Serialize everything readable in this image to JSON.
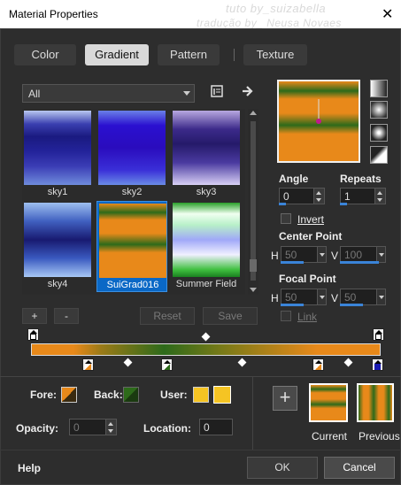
{
  "window": {
    "title": "Material Properties",
    "watermark_line1": "tuto by_suizabella",
    "watermark_line2": "tradução by_ Neusa Novaes",
    "close_label": "✕"
  },
  "tabs": [
    {
      "label": "Color",
      "active": false
    },
    {
      "label": "Gradient",
      "active": true
    },
    {
      "label": "Pattern",
      "active": false
    },
    {
      "label": "Texture",
      "active": false
    }
  ],
  "category_dropdown": {
    "value": "All"
  },
  "gradients": [
    {
      "name": "sky1"
    },
    {
      "name": "sky2"
    },
    {
      "name": "sky3"
    },
    {
      "name": "sky4"
    },
    {
      "name": "SuiGrad016",
      "selected": true
    },
    {
      "name": "Summer Field"
    }
  ],
  "library_buttons": {
    "add": "+",
    "remove": "-",
    "reset": "Reset",
    "save": "Save"
  },
  "angle": {
    "label": "Angle",
    "value": "0"
  },
  "repeats": {
    "label": "Repeats",
    "value": "1"
  },
  "invert": {
    "label": "Invert",
    "checked": false
  },
  "center_point": {
    "label": "Center Point",
    "h_label": "H",
    "h_value": "50",
    "v_label": "V",
    "v_value": "100"
  },
  "focal_point": {
    "label": "Focal Point",
    "h_label": "H",
    "h_value": "50",
    "v_label": "V",
    "v_value": "50"
  },
  "link": {
    "label": "Link",
    "checked": false
  },
  "stops": {
    "fore_label": "Fore:",
    "back_label": "Back:",
    "user_label": "User:",
    "opacity_label": "Opacity:",
    "opacity_value": "0",
    "location_label": "Location:",
    "location_value": "0"
  },
  "colors": {
    "orange": "#e8891a",
    "green": "#2d6a1a",
    "yellow": "#f5c423",
    "accent": "#3a84d8"
  },
  "result": {
    "add": "+",
    "current_label": "Current",
    "previous_label": "Previous"
  },
  "footer": {
    "help": "Help",
    "ok": "OK",
    "cancel": "Cancel"
  }
}
